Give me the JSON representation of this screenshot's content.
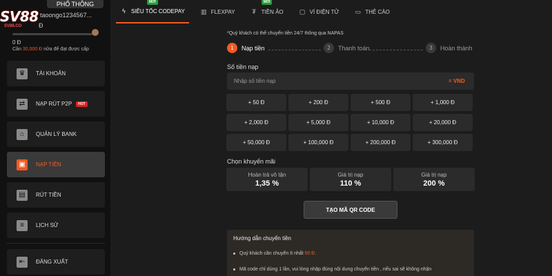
{
  "sidebar": {
    "logo_text": "SV88",
    "logo_sub": "SV88.CO",
    "rank": "PHỔ THÔNG",
    "username": "taoongo1234567...",
    "username_suffix": "Đ",
    "balance": "0 Đ",
    "level_progress": 0.0,
    "level_hint_prefix": "Cần ",
    "level_hint_amount": "30,000 Đ",
    "level_hint_suffix": " nữa để đạt được cấp",
    "items": [
      {
        "label": "TÀI KHOẢN",
        "icon": "crown-icon",
        "glyph": "♛",
        "active": false,
        "hot": ""
      },
      {
        "label": "NẠP RÚT P2P",
        "icon": "p2p-icon",
        "glyph": "⇄",
        "active": false,
        "hot": "HOT"
      },
      {
        "label": "QUẢN LÝ BANK",
        "icon": "bank-icon",
        "glyph": "⌂",
        "active": false,
        "hot": ""
      },
      {
        "label": "NẠP TIỀN",
        "icon": "deposit-icon",
        "glyph": "▣",
        "active": true,
        "hot": ""
      },
      {
        "label": "RÚT TIỀN",
        "icon": "withdraw-icon",
        "glyph": "▤",
        "active": false,
        "hot": ""
      },
      {
        "label": "LỊCH SỬ",
        "icon": "history-icon",
        "glyph": "≡",
        "active": false,
        "hot": ""
      },
      {
        "label": "ĐĂNG XUẤT",
        "icon": "logout-icon",
        "glyph": "⇤",
        "active": false,
        "hot": ""
      }
    ]
  },
  "tabs": [
    {
      "label": "SIÊU TỐC CODEPAY",
      "icon": "lightning-icon",
      "glyph": "ϟ",
      "badge": "MỚI",
      "active": true
    },
    {
      "label": "FLEXPAY",
      "icon": "flexpay-icon",
      "glyph": "▥",
      "badge": "",
      "active": false
    },
    {
      "label": "TIỀN ẢO",
      "icon": "crypto-icon",
      "glyph": "₮",
      "badge": "MỚI",
      "active": false
    },
    {
      "label": "VÍ ĐIỆN TỬ",
      "icon": "wallet-icon",
      "glyph": "▢",
      "badge": "",
      "active": false
    },
    {
      "label": "THẺ CÀO",
      "icon": "card-icon",
      "glyph": "▭",
      "badge": "",
      "active": false
    }
  ],
  "napas_note": "*Quý khách có thể chuyển tiền 24/7 thông qua NAPAS",
  "steps": [
    {
      "num": "1",
      "label": "Nạp tiền",
      "active": true
    },
    {
      "num": "2",
      "label": "Thanh toán",
      "active": false
    },
    {
      "num": "3",
      "label": "Hoàn thành",
      "active": false
    }
  ],
  "amount": {
    "label": "Số tiền nạp",
    "placeholder": "Nhập số tiền nạp",
    "currency": "= VND"
  },
  "amount_options": [
    "+ 50 Đ",
    "+ 200 Đ",
    "+ 500 Đ",
    "+ 1,000 Đ",
    "+ 2,000 Đ",
    "+ 5,000 Đ",
    "+ 10,000 Đ",
    "+ 20,000 Đ",
    "+ 50,000 Đ",
    "+ 100,000 Đ",
    "+ 200,000 Đ",
    "+ 300,000 Đ"
  ],
  "promo": {
    "label": "Chọn khuyến mãi",
    "options": [
      {
        "title": "Hoàn trả vô tận",
        "value": "1,35 %"
      },
      {
        "title": "Giá trị nạp",
        "value": "110 %"
      },
      {
        "title": "Giá trị nạp",
        "value": "200 %"
      }
    ]
  },
  "qr_button": "TẠO MÃ QR CODE",
  "guide": {
    "title": "Hướng dẫn chuyển tiền",
    "line1_prefix": "Quý khách cần chuyển ít nhất ",
    "line1_highlight": "50 Đ.",
    "line2": "Mã code chỉ dùng 1 lần, vui lòng nhập đúng nội dung chuyển tiền , nếu sai sẽ không nhận"
  }
}
